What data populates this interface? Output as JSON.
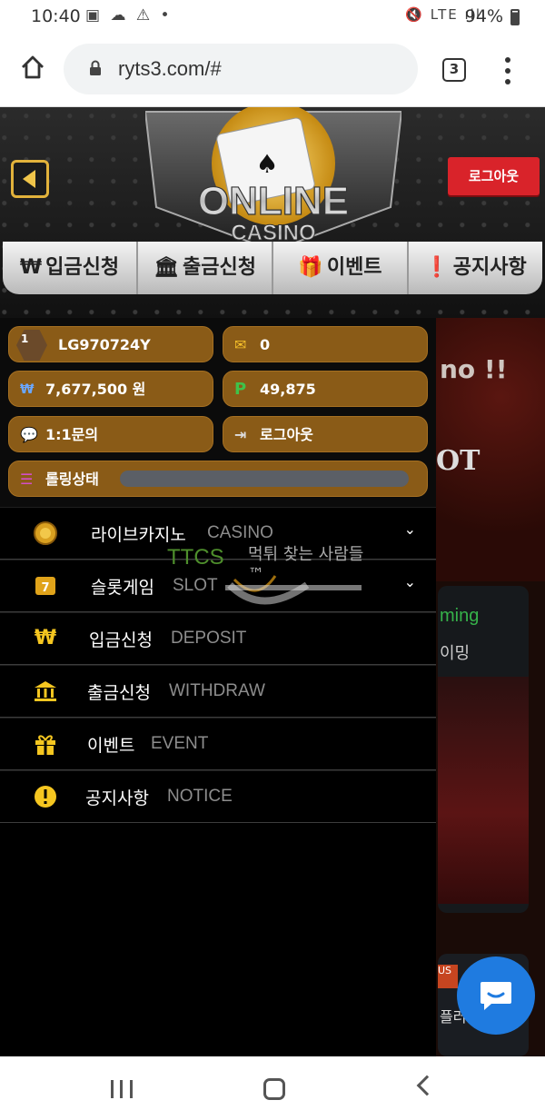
{
  "status_bar": {
    "time": "10:40",
    "left_icons": "▣ ☁ ⚠ •",
    "right_icons": "🔇 LTE ıll",
    "battery": "94%"
  },
  "browser": {
    "url": "ryts3.com/#",
    "tab_count": "3"
  },
  "header": {
    "logo_text": "ONLINE",
    "logo_sub": "CASINO",
    "logout_button": "로그아웃",
    "nav": [
      {
        "icon": "₩",
        "label": "입금신청"
      },
      {
        "icon": "🏛",
        "label": "출금신청"
      },
      {
        "icon": "🎁",
        "label": "이벤트"
      },
      {
        "icon": "❗",
        "label": "공지사항"
      }
    ]
  },
  "user_panel": {
    "rank": "1",
    "username": "LG970724Y",
    "messages": "0",
    "balance": "7,677,500 원",
    "points": "49,875",
    "inquiry_label": "1:1문의",
    "logout_label": "로그아웃",
    "rolling_label": "롤링상태",
    "rolling_progress": 0
  },
  "menu": [
    {
      "ko": "라이브카지노",
      "en": "CASINO",
      "icon": "casino-chip-icon",
      "has_chevron": true
    },
    {
      "ko": "슬롯게임",
      "en": "SLOT",
      "icon": "slot-777-icon",
      "has_chevron": true
    },
    {
      "ko": "입금신청",
      "en": "DEPOSIT",
      "icon": "won-icon",
      "has_chevron": false
    },
    {
      "ko": "출금신청",
      "en": "WITHDRAW",
      "icon": "bank-icon",
      "has_chevron": false
    },
    {
      "ko": "이벤트",
      "en": "EVENT",
      "icon": "gift-icon",
      "has_chevron": false
    },
    {
      "ko": "공지사항",
      "en": "NOTICE",
      "icon": "alert-icon",
      "has_chevron": false
    }
  ],
  "background_page": {
    "banner_text": "no !!",
    "slot_text": "OT",
    "card_title": "ming",
    "card_sub": "이밍",
    "card2_badge": "US",
    "card2_text": "플러"
  },
  "watermark": {
    "brand": "TTCS",
    "tagline": "먹튀 찾는 사람들™"
  },
  "colors": {
    "accent_gold": "#8a5b17",
    "logout_red": "#d9232a",
    "chat_blue": "#1f7be0",
    "icon_yellow": "#f5c620"
  }
}
